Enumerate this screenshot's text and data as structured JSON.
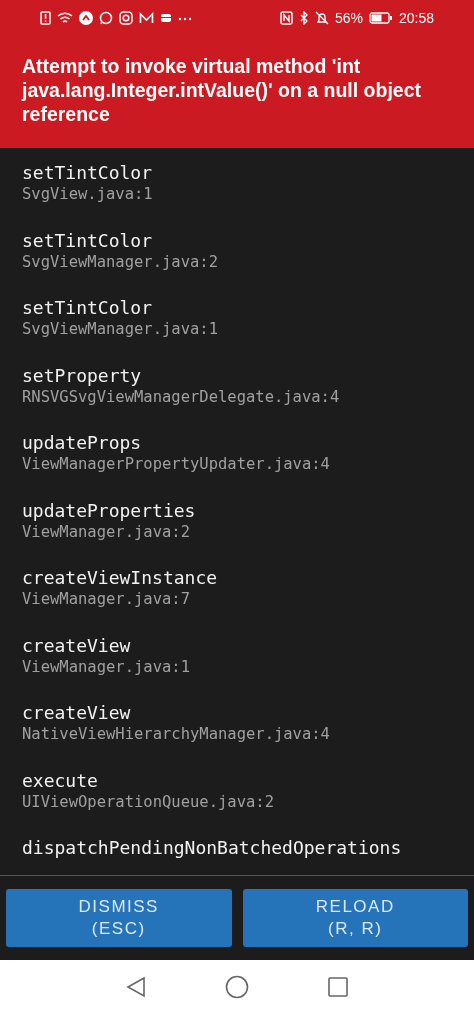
{
  "status_bar": {
    "battery_percent": "56%",
    "time": "20:58"
  },
  "error_message": "Attempt to invoke virtual method 'int java.lang.Integer.intValue()' on a null object reference",
  "stack_frames": [
    {
      "method": "setTintColor",
      "file": "SvgView.java:1"
    },
    {
      "method": "setTintColor",
      "file": "SvgViewManager.java:2"
    },
    {
      "method": "setTintColor",
      "file": "SvgViewManager.java:1"
    },
    {
      "method": "setProperty",
      "file": "RNSVGSvgViewManagerDelegate.java:4"
    },
    {
      "method": "updateProps",
      "file": "ViewManagerPropertyUpdater.java:4"
    },
    {
      "method": "updateProperties",
      "file": "ViewManager.java:2"
    },
    {
      "method": "createViewInstance",
      "file": "ViewManager.java:7"
    },
    {
      "method": "createView",
      "file": "ViewManager.java:1"
    },
    {
      "method": "createView",
      "file": "NativeViewHierarchyManager.java:4"
    },
    {
      "method": "execute",
      "file": "UIViewOperationQueue.java:2"
    },
    {
      "method": "dispatchPendingNonBatchedOperations"
    }
  ],
  "buttons": [
    {
      "label": "DISMISS",
      "shortcut": "(ESC)"
    },
    {
      "label": "RELOAD",
      "shortcut": "(R, R)"
    }
  ]
}
